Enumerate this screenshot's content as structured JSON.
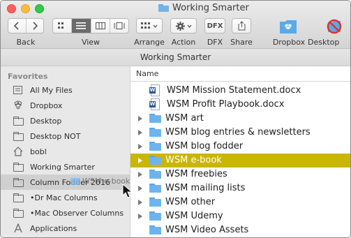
{
  "window": {
    "title": "Working Smarter"
  },
  "toolbar": {
    "back_label": "Back",
    "view_label": "View",
    "arrange_label": "Arrange",
    "action_label": "Action",
    "dfx_label": "DFX",
    "share_label": "Share",
    "dropbox_label": "Dropbox",
    "desktop_not_label": "Desktop NOT",
    "dfx_text": "DFX"
  },
  "pathbar": {
    "title": "Working Smarter"
  },
  "sidebar": {
    "header": "Favorites",
    "items": [
      {
        "label": "All My Files",
        "icon": "all-files-icon"
      },
      {
        "label": "Dropbox",
        "icon": "dropbox-icon"
      },
      {
        "label": "Desktop",
        "icon": "folder-icon"
      },
      {
        "label": "Desktop NOT",
        "icon": "folder-icon"
      },
      {
        "label": "bobl",
        "icon": "home-icon"
      },
      {
        "label": "Working Smarter",
        "icon": "folder-icon"
      },
      {
        "label": "Column Fodder 2016",
        "icon": "folder-icon"
      },
      {
        "label": "•Dr Mac Columns",
        "icon": "folder-icon"
      },
      {
        "label": "•Mac Observer Columns",
        "icon": "folder-icon"
      },
      {
        "label": "Applications",
        "icon": "applications-icon"
      }
    ]
  },
  "drag": {
    "label": "WSM e-book"
  },
  "list": {
    "column_name": "Name",
    "rows": [
      {
        "name": "WSM Mission Statement.docx",
        "kind": "doc"
      },
      {
        "name": "WSM Profit Playbook.docx",
        "kind": "doc"
      },
      {
        "name": "WSM art",
        "kind": "folder"
      },
      {
        "name": "WSM blog entries & newsletters",
        "kind": "folder"
      },
      {
        "name": "WSM blog fodder",
        "kind": "folder"
      },
      {
        "name": "WSM e-book",
        "kind": "folder",
        "selected": true
      },
      {
        "name": "WSM freebies",
        "kind": "folder"
      },
      {
        "name": "WSM mailing lists",
        "kind": "folder"
      },
      {
        "name": "WSM other",
        "kind": "folder"
      },
      {
        "name": "WSM Udemy",
        "kind": "folder"
      },
      {
        "name": "WSM Video Assets",
        "kind": "folder-alias"
      }
    ]
  },
  "colors": {
    "selection": "#c9b600",
    "folder": "#6db4ee"
  }
}
